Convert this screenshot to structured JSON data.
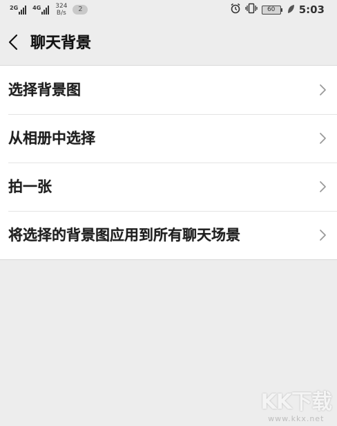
{
  "status_bar": {
    "sim1_network": "2G",
    "sim2_network": "4G",
    "net_speed_value": "324",
    "net_speed_unit": "B/s",
    "notification_count": "2",
    "battery_level": "60",
    "time": "5:03",
    "icons": [
      "alarm-icon",
      "vibrate-icon",
      "battery-icon",
      "leaf-icon"
    ]
  },
  "header": {
    "title": "聊天背景",
    "back_icon": "chevron-left-icon"
  },
  "menu": {
    "items": [
      {
        "label": "选择背景图"
      },
      {
        "label": "从相册中选择"
      },
      {
        "label": "拍一张"
      },
      {
        "label": "将选择的背景图应用到所有聊天场景"
      }
    ]
  },
  "watermark": {
    "logo": "KK下载",
    "url": "www.kkx.net"
  },
  "colors": {
    "page_background": "#ededed",
    "list_background": "#ffffff",
    "text": "#1a1a1a",
    "chevron": "#9a9a9a"
  }
}
